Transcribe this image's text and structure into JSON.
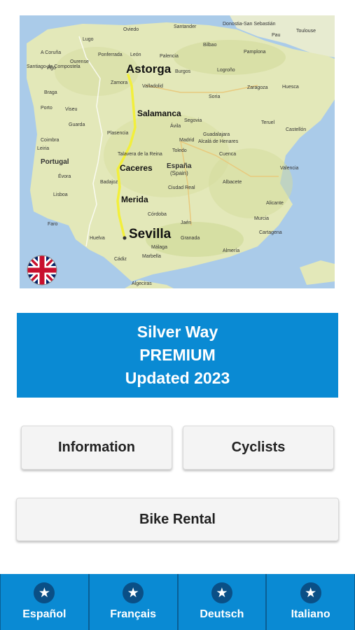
{
  "map": {
    "cities": {
      "astorga": "Astorga",
      "salamanca": "Salamanca",
      "caceres": "Caceres",
      "merida": "Merida",
      "sevilla": "Sevilla"
    },
    "small_labels": {
      "portugal": "Portugal",
      "espana": "España",
      "spain": "(Spain)",
      "lisboa": "Lisboa",
      "madrid": "Madrid",
      "valencia": "Valencia",
      "zaragoza": "Zaragoza",
      "bilbao": "Bilbao",
      "toulouse": "Toulouse",
      "granada": "Granada",
      "malaga": "Málaga",
      "cordoba": "Córdoba",
      "murcia": "Murcia",
      "alicante": "Alicante",
      "valladolid": "Valladolid",
      "leon": "León",
      "oviedo": "Oviedo",
      "santander": "Santander",
      "burgos": "Burgos",
      "avila": "Ávila",
      "segovia": "Segovia",
      "toledo": "Toledo",
      "badajoz": "Badajoz",
      "cadiz": "Cádiz",
      "huelva": "Huelva",
      "porto": "Porto",
      "vigo": "Vigo",
      "lugo": "Lugo",
      "coruna": "A Coruña",
      "cuenca": "Cuenca",
      "albacete": "Albacete",
      "jaen": "Jaén",
      "almeria": "Almería",
      "pamplona": "Pamplona",
      "logrono": "Logroño",
      "soria": "Soria",
      "huesca": "Huesca",
      "teruel": "Teruel",
      "castellon": "Castellón",
      "ciudad_real": "Ciudad Real",
      "cartagena": "Cartagena",
      "coimbra": "Coimbra",
      "braga": "Braga",
      "faro": "Faro",
      "evora": "Évora",
      "guarda": "Guarda",
      "viseu": "Viseu",
      "leiria": "Leiria",
      "zamora": "Zamora",
      "orense": "Ourense",
      "palencia": "Palencia",
      "ponferrada": "Ponferrada",
      "santiago": "Santiago de Compostela",
      "algeciras": "Algeciras",
      "marbella": "Marbella",
      "guadalajara": "Guadalajara",
      "plasencia": "Plasencia",
      "talavera": "Talavera de la Reina",
      "alcala": "Alcalá de Henares",
      "donostia": "Donostia-San Sebastián",
      "pau": "Pau"
    }
  },
  "flag_icon": "uk-flag-icon",
  "banner": {
    "line1": "Silver Way",
    "line2": "PREMIUM",
    "line3": "Updated 2023"
  },
  "buttons": {
    "information": "Information",
    "cyclists": "Cyclists",
    "bike_rental": "Bike Rental"
  },
  "languages": [
    {
      "label": "Español",
      "icon": "star-icon"
    },
    {
      "label": "Français",
      "icon": "star-icon"
    },
    {
      "label": "Deutsch",
      "icon": "star-icon"
    },
    {
      "label": "Italiano",
      "icon": "star-icon"
    }
  ],
  "colors": {
    "accent": "#0a8ad3",
    "route": "#f2ef3c",
    "land": "#e3e8b9",
    "sea": "#aacbe9"
  }
}
